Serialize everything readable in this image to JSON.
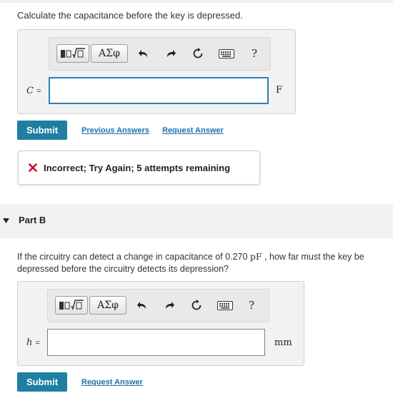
{
  "part_a": {
    "question": "Calculate the capacitance before the key is depressed.",
    "variable": "C",
    "equals": "=",
    "unit": "F",
    "answer_value": "",
    "submit_label": "Submit",
    "previous_answers_label": "Previous Answers",
    "request_answer_label": "Request Answer",
    "feedback": "Incorrect; Try Again; 5 attempts remaining"
  },
  "toolbar": {
    "greek_label": "ΑΣφ",
    "help_label": "?"
  },
  "part_b": {
    "header": "Part B",
    "question_prefix": "If the circuitry can detect a change in capacitance of 0.270 ",
    "question_unit": "pF",
    "question_suffix": " , how far must the key be",
    "question_line2": "depressed before the circuitry detects its depression?",
    "variable": "h",
    "equals": "=",
    "unit": "mm",
    "answer_value": "",
    "submit_label": "Submit",
    "request_answer_label": "Request Answer"
  },
  "colors": {
    "submit": "#1e7fa3",
    "link": "#1c71a8",
    "focus": "#2d7fb8",
    "error": "#c8102e"
  }
}
